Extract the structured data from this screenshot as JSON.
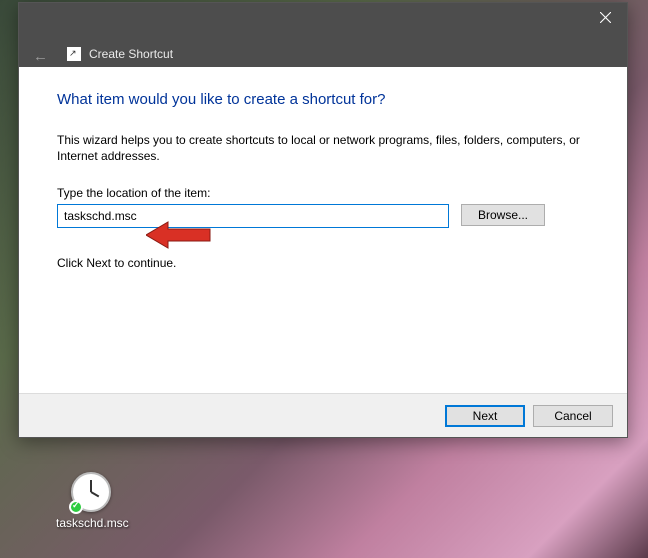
{
  "dialog": {
    "title": "Create Shortcut",
    "heading": "What item would you like to create a shortcut for?",
    "description": "This wizard helps you to create shortcuts to local or network programs, files, folders, computers, or Internet addresses.",
    "field_label": "Type the location of the item:",
    "location_value": "taskschd.msc",
    "browse_label": "Browse...",
    "continue_text": "Click Next to continue.",
    "next_label": "Next",
    "cancel_label": "Cancel"
  },
  "desktop": {
    "shortcut_label": "taskschd.msc"
  }
}
